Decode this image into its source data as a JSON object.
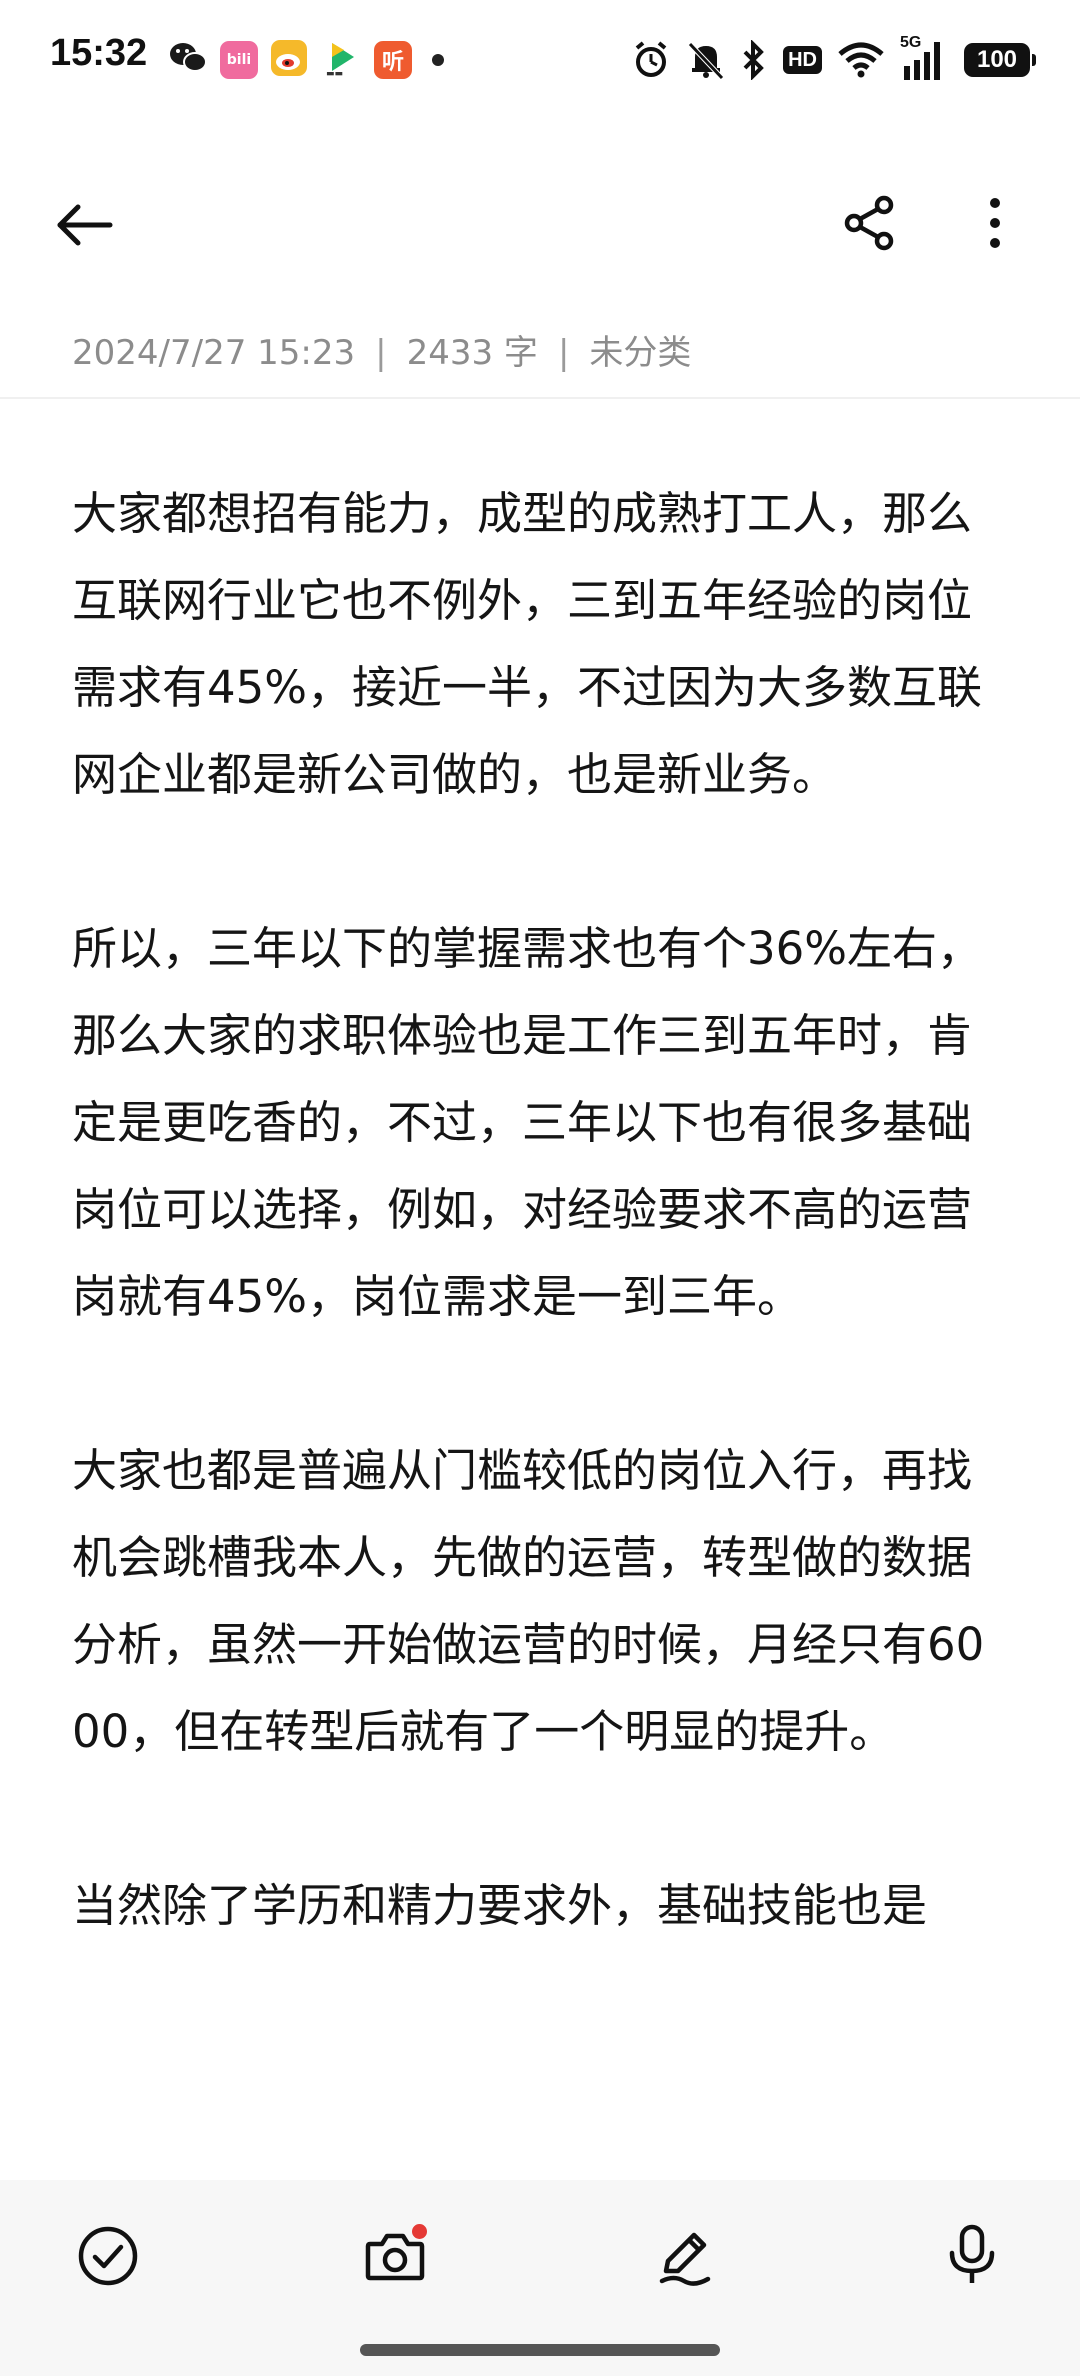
{
  "status_bar": {
    "time": "15:32",
    "hd_label": "HD",
    "network_label": "5G",
    "battery": "100",
    "notification_icons": [
      "wechat-icon",
      "bilibili-icon",
      "weibo-icon",
      "video-app-icon",
      "ting-icon"
    ],
    "ting_label": "听",
    "bili_label": "bili"
  },
  "toolbar": {
    "back_icon": "arrow-left-icon",
    "share_icon": "share-icon",
    "more_icon": "more-vertical-icon"
  },
  "meta": {
    "datetime": "2024/7/27 15:23",
    "word_count": "2433 字",
    "category": "未分类",
    "separator": "|"
  },
  "content": {
    "paragraphs": [
      "大家都想招有能力，成型的成熟打工人，那么互联网行业它也不例外，三到五年经验的岗位需求有45%，接近一半，不过因为大多数互联网企业都是新公司做的，也是新业务。",
      "所以，三年以下的掌握需求也有个36%左右，那么大家的求职体验也是工作三到五年时，肯定是更吃香的，不过，三年以下也有很多基础岗位可以选择，例如，对经验要求不高的运营岗就有45%，岗位需求是一到三年。",
      "大家也都是普遍从门槛较低的岗位入行，再找机会跳槽我本人，先做的运营，转型做的数据分析，虽然一开始做运营的时候，月经只有6000，但在转型后就有了一个明显的提升。",
      "当然除了学历和精力要求外，基础技能也是"
    ]
  },
  "bottom_bar": {
    "items": [
      "checkmark-circle-icon",
      "camera-icon",
      "pen-icon",
      "microphone-icon"
    ]
  },
  "colors": {
    "meta_text": "#8c8c8c",
    "body_text": "#151515",
    "camera_badge": "#e53935",
    "bottom_bar_bg": "#f7f7f7"
  }
}
